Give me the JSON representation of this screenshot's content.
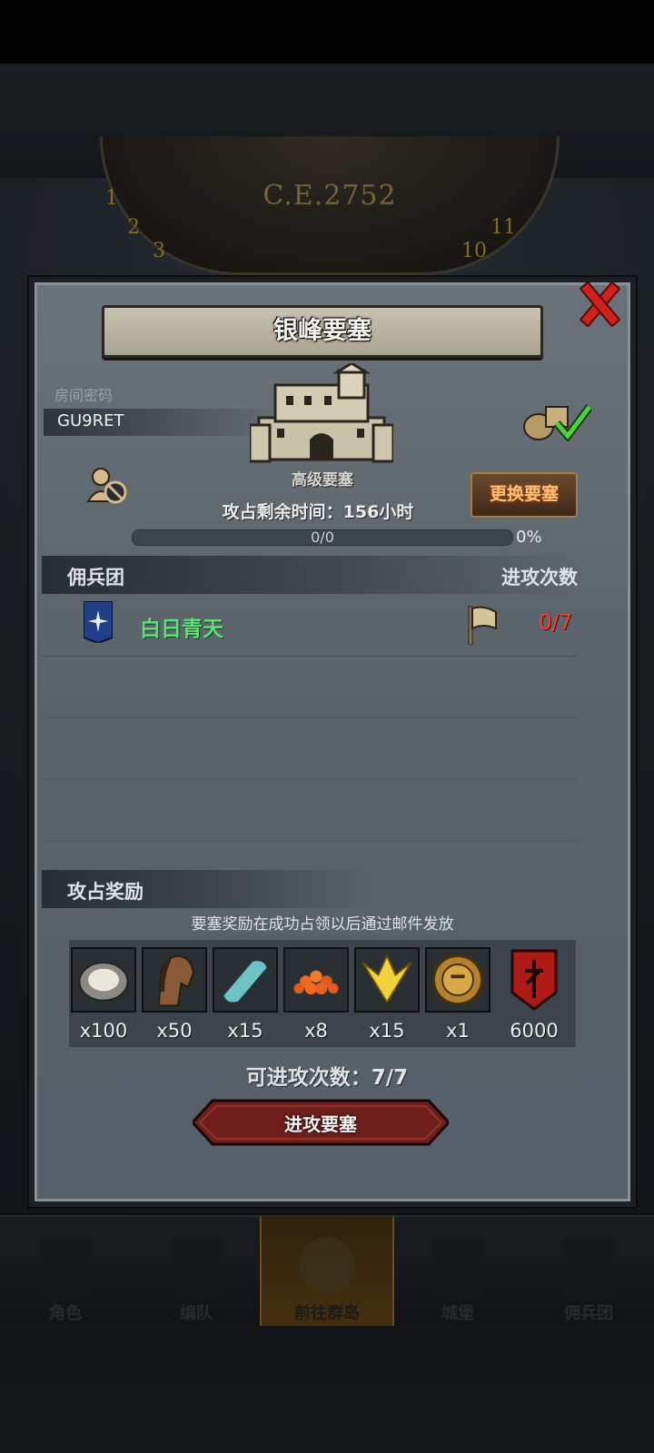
{
  "background": {
    "era_dial_text": "C.E.2752",
    "dial_numbers": [
      "1",
      "2",
      "3",
      "11",
      "10"
    ]
  },
  "bottom_nav": {
    "items": [
      {
        "label": "角色",
        "icon": "knight-helmet-icon"
      },
      {
        "label": "编队",
        "icon": "formation-icon"
      },
      {
        "label": "前往群岛",
        "icon": "world-map-icon",
        "active": true
      },
      {
        "label": "城堡",
        "icon": "castle-icon"
      },
      {
        "label": "佣兵团",
        "icon": "mercenary-icon"
      }
    ]
  },
  "dialog": {
    "title": "银峰要塞",
    "room_label": "房间密码",
    "room_code": "GU9RET",
    "fortress_type": "高级要塞",
    "change_button": "更换要塞",
    "time_label": "攻占剩余时间：156小时",
    "progress": {
      "text": "0/0",
      "percent_text": "0%",
      "fraction": 0
    },
    "mercenary_header": "佣兵团",
    "attacks_header": "进攻次数",
    "mercenaries": [
      {
        "name": "白日青天",
        "attacks": "0/7"
      }
    ],
    "reward_header": "攻占奖励",
    "reward_note": "要塞奖励在成功占领以后通过邮件发放",
    "rewards": [
      {
        "icon": "oyster-icon",
        "count": "x100"
      },
      {
        "icon": "horse-icon",
        "count": "x50"
      },
      {
        "icon": "cloth-icon",
        "count": "x15"
      },
      {
        "icon": "roe-icon",
        "count": "x8"
      },
      {
        "icon": "gold-crest-icon",
        "count": "x15"
      },
      {
        "icon": "helmet-medal-icon",
        "count": "x1"
      },
      {
        "icon": "red-banner-icon",
        "count": "6000"
      }
    ],
    "attack_count_label": "可进攻次数：7/7",
    "attack_button": "进攻要塞"
  },
  "colors": {
    "accent_gold": "#d8a23a",
    "green_name": "#5fe07a",
    "red_count": "#ff3b2f",
    "close_red": "#d0221c"
  }
}
